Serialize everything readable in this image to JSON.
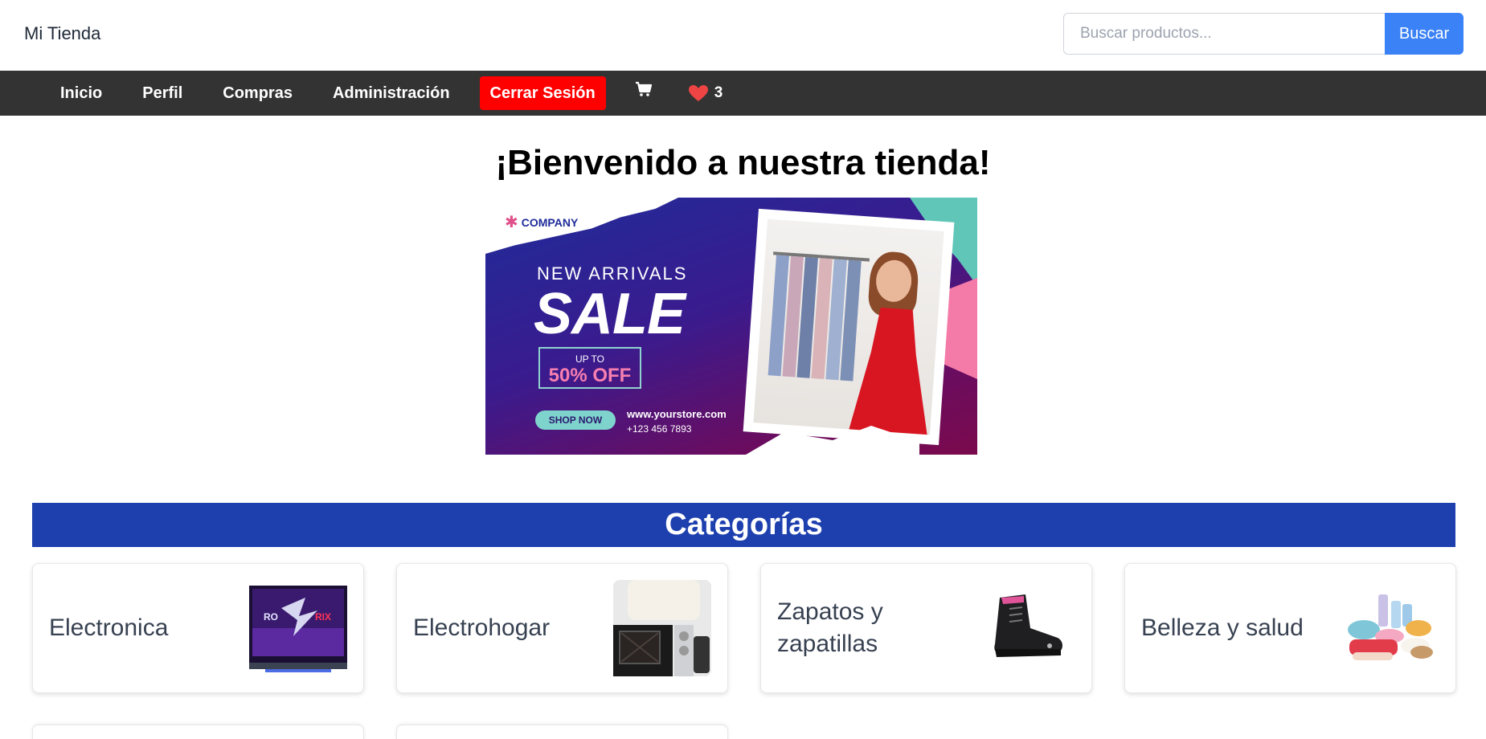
{
  "header": {
    "brand": "Mi Tienda",
    "search": {
      "placeholder": "Buscar productos...",
      "value": "",
      "button_label": "Buscar"
    }
  },
  "nav": {
    "items": [
      {
        "label": "Inicio"
      },
      {
        "label": "Perfil"
      },
      {
        "label": "Compras"
      },
      {
        "label": "Administración"
      }
    ],
    "logout_label": "Cerrar Sesión",
    "cart_icon": "cart-icon",
    "favorites": {
      "icon": "heart-icon",
      "count": "3"
    }
  },
  "main": {
    "welcome": "¡Bienvenido a nuestra tienda!",
    "banner": {
      "company": "COMPANY",
      "headline": "NEW ARRIVALS",
      "sale": "SALE",
      "up_to": "UP TO",
      "discount": "50% OFF",
      "cta": "SHOP NOW",
      "website": "www.yourstore.com",
      "phone": "+123 456 7893"
    },
    "categories_title": "Categorías",
    "categories": [
      {
        "label": "Electronica",
        "image": "laptop"
      },
      {
        "label": "Electrohogar",
        "image": "appliances"
      },
      {
        "label": "Zapatos y zapatillas",
        "image": "boot"
      },
      {
        "label": "Belleza y salud",
        "image": "cosmetics"
      }
    ]
  },
  "colors": {
    "nav_bg": "#333333",
    "logout_bg": "#ff0000",
    "search_btn": "#3b82f6",
    "categories_bg": "#1e40af",
    "heart": "#ef4444"
  }
}
